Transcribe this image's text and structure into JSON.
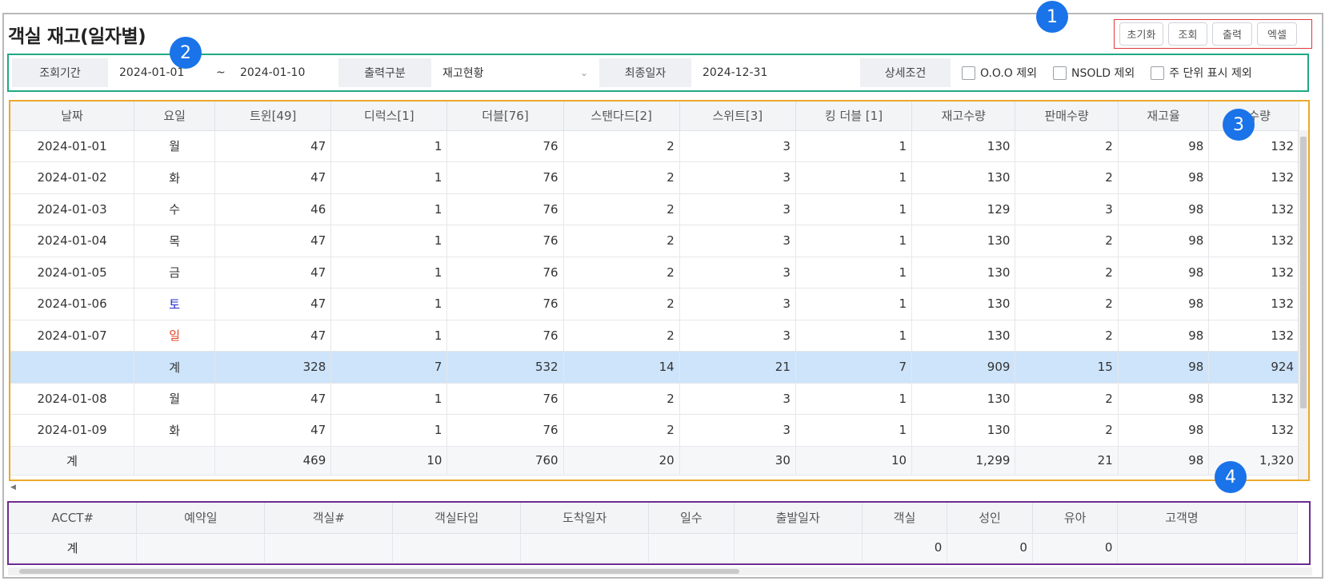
{
  "page": {
    "title": "객실 재고(일자별)"
  },
  "toolbar": {
    "reset": "초기화",
    "search": "조회",
    "print": "출력",
    "excel": "엑셀"
  },
  "filter": {
    "period_label": "조회기간",
    "date_from": "2024-01-01",
    "tilde": "~",
    "date_to": "2024-01-10",
    "output_label": "출력구분",
    "output_value": "재고현황",
    "last_date_label": "최종일자",
    "last_date_value": "2024-12-31",
    "detail_label": "상세조건",
    "options": [
      "O.O.O 제외",
      "NSOLD 제외",
      "주 단위 표시 제외"
    ]
  },
  "grid": {
    "columns": [
      "날짜",
      "요일",
      "트윈[49]",
      "디럭스[1]",
      "더블[76]",
      "스탠다드[2]",
      "스위트[3]",
      "킹 더블 [1]",
      "재고수량",
      "판매수량",
      "재고율",
      "총수량"
    ],
    "rows": [
      {
        "date": "2024-01-01",
        "day": "월",
        "cells": [
          "47",
          "1",
          "76",
          "2",
          "3",
          "1",
          "130",
          "2",
          "98",
          "132"
        ]
      },
      {
        "date": "2024-01-02",
        "day": "화",
        "cells": [
          "47",
          "1",
          "76",
          "2",
          "3",
          "1",
          "130",
          "2",
          "98",
          "132"
        ]
      },
      {
        "date": "2024-01-03",
        "day": "수",
        "cells": [
          "46",
          "1",
          "76",
          "2",
          "3",
          "1",
          "129",
          "3",
          "98",
          "132"
        ]
      },
      {
        "date": "2024-01-04",
        "day": "목",
        "cells": [
          "47",
          "1",
          "76",
          "2",
          "3",
          "1",
          "130",
          "2",
          "98",
          "132"
        ]
      },
      {
        "date": "2024-01-05",
        "day": "금",
        "cells": [
          "47",
          "1",
          "76",
          "2",
          "3",
          "1",
          "130",
          "2",
          "98",
          "132"
        ]
      },
      {
        "date": "2024-01-06",
        "day": "토",
        "cells": [
          "47",
          "1",
          "76",
          "2",
          "3",
          "1",
          "130",
          "2",
          "98",
          "132"
        ]
      },
      {
        "date": "2024-01-07",
        "day": "일",
        "cells": [
          "47",
          "1",
          "76",
          "2",
          "3",
          "1",
          "130",
          "2",
          "98",
          "132"
        ]
      },
      {
        "date": "",
        "day": "계",
        "cells": [
          "328",
          "7",
          "532",
          "14",
          "21",
          "7",
          "909",
          "15",
          "98",
          "924"
        ],
        "subtotal": true
      },
      {
        "date": "2024-01-08",
        "day": "월",
        "cells": [
          "47",
          "1",
          "76",
          "2",
          "3",
          "1",
          "130",
          "2",
          "98",
          "132"
        ]
      },
      {
        "date": "2024-01-09",
        "day": "화",
        "cells": [
          "47",
          "1",
          "76",
          "2",
          "3",
          "1",
          "130",
          "2",
          "98",
          "132"
        ]
      }
    ],
    "footer": {
      "label": "계",
      "cells": [
        "469",
        "10",
        "760",
        "20",
        "30",
        "10",
        "1,299",
        "21",
        "98",
        "1,320"
      ]
    }
  },
  "detail": {
    "columns": [
      "ACCT#",
      "예약일",
      "객실#",
      "객실타입",
      "도착일자",
      "일수",
      "출발일자",
      "객실",
      "성인",
      "유아",
      "고객명"
    ],
    "footer": {
      "label": "계",
      "values": [
        "",
        "",
        "",
        "",
        "",
        "",
        "0",
        "0",
        "0",
        ""
      ]
    }
  },
  "markers": [
    "1",
    "2",
    "3",
    "4"
  ]
}
